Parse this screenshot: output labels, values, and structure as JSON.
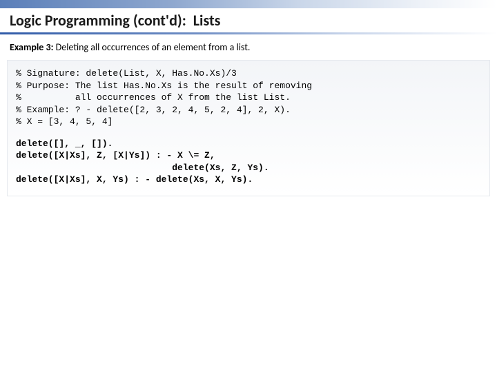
{
  "title": {
    "main": "Logic Programming (cont'd):",
    "sub": "Lists"
  },
  "example": {
    "label_bold": "Example 3:",
    "label_rest": "  Deleting all occurrences of an element from a list."
  },
  "code": {
    "comment1": "% Signature: delete(List, X, Has.No.Xs)/3",
    "comment2": "% Purpose: The list Has.No.Xs is the result of removing",
    "comment3": "%          all occurrences of X from the list List.",
    "comment4": "% Example: ? - delete([2, 3, 2, 4, 5, 2, 4], 2, X).",
    "comment5": "% X = [3, 4, 5, 4]",
    "rule1": "delete([], _, []).",
    "rule2": "delete([X|Xs], Z, [X|Ys]) : - X \\= Z,",
    "rule2b": "                             delete(Xs, Z, Ys).",
    "rule3": "delete([X|Xs], X, Ys) : - delete(Xs, X, Ys)."
  }
}
